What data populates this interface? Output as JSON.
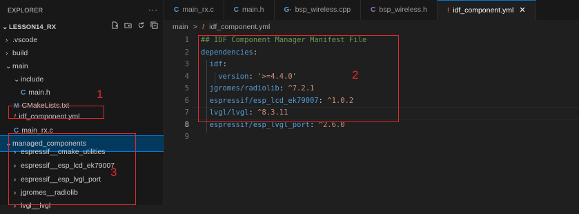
{
  "explorer": {
    "title": "EXPLORER",
    "more": "···",
    "project": "LESSON14_RX",
    "items": [
      {
        "label": ".vscode",
        "chev": "›",
        "icon": ""
      },
      {
        "label": "build",
        "chev": "›",
        "icon": ""
      },
      {
        "label": "main",
        "chev": "⌄",
        "icon": ""
      },
      {
        "label": "include",
        "chev": "⌄",
        "icon": ""
      },
      {
        "label": "main.h",
        "chev": "",
        "icon": "C"
      },
      {
        "label": "CMakeLists.txt",
        "chev": "",
        "icon": "M"
      },
      {
        "label": "idf_component.yml",
        "chev": "",
        "icon": "!"
      },
      {
        "label": "main_rx.c",
        "chev": "",
        "icon": "C"
      },
      {
        "label": "managed_components",
        "chev": "⌄",
        "icon": ""
      },
      {
        "label": "espressif__cmake_utilities",
        "chev": "›",
        "icon": ""
      },
      {
        "label": "espressif__esp_lcd_ek79007",
        "chev": "›",
        "icon": ""
      },
      {
        "label": "espressif__esp_lvgl_port",
        "chev": "›",
        "icon": ""
      },
      {
        "label": "jgromes__radiolib",
        "chev": "›",
        "icon": ""
      },
      {
        "label": "lvgl__lvgl",
        "chev": "›",
        "icon": ""
      }
    ]
  },
  "tabs": [
    {
      "label": "main_rx.c",
      "icon": "C",
      "icon_color": "#599cd6"
    },
    {
      "label": "main.h",
      "icon": "C",
      "icon_color": "#599cd6"
    },
    {
      "label": "bsp_wireless.cpp",
      "icon": "G·",
      "icon_color": "#599cd6"
    },
    {
      "label": "bsp_wireless.h",
      "icon": "C",
      "icon_color": "#a074c4"
    },
    {
      "label": "idf_component.yml",
      "icon": "!",
      "icon_color": "#cc6633",
      "close": "✕"
    }
  ],
  "breadcrumb": {
    "folder": "main",
    "separator": ">",
    "file": "idf_component.yml"
  },
  "editor": {
    "line_numbers": [
      "1",
      "2",
      "3",
      "4",
      "5",
      "6",
      "7",
      "8",
      "9"
    ],
    "current_line": 8,
    "lines": [
      {
        "k": "## IDF Component Manager Manifest File",
        "s": "",
        "t": "comment",
        "indent": 0
      },
      {
        "k": "dependencies",
        "s": "",
        "t": "key",
        "indent": 0
      },
      {
        "k": "idf",
        "s": "",
        "t": "key",
        "indent": 1
      },
      {
        "k": "version",
        "s": "'>=4.4.0'",
        "t": "kv",
        "indent": 2
      },
      {
        "k": "jgromes/radiolib",
        "s": "^7.2.1",
        "t": "kv",
        "indent": 1
      },
      {
        "k": "espressif/esp_lcd_ek79007",
        "s": "^1.0.2",
        "t": "kv",
        "indent": 1
      },
      {
        "k": "lvgl/lvgl",
        "s": "^8.3.11",
        "t": "kv",
        "indent": 1
      },
      {
        "k": "espressif/esp_lvgl_port",
        "s": "^2.6.0",
        "t": "kv",
        "indent": 1
      },
      {
        "k": "",
        "s": "",
        "t": "empty",
        "indent": 0
      }
    ]
  },
  "annotations": {
    "one": "1",
    "two": "2",
    "three": "3"
  },
  "colors": {
    "annotation": "#e02a2a",
    "selection": "#04395e",
    "accent": "#0078d4"
  }
}
